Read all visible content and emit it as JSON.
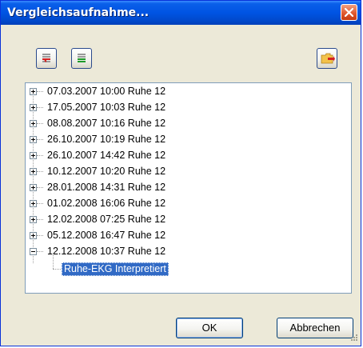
{
  "window": {
    "title": "Vergleichsaufnahme..."
  },
  "toolbar": {
    "buttons": [
      {
        "name": "list-red-icon"
      },
      {
        "name": "list-green-icon"
      },
      {
        "name": "folder-export-icon"
      }
    ]
  },
  "tree": {
    "recordings": [
      {
        "label": "07.03.2007 10:00  Ruhe 12",
        "expanded": false
      },
      {
        "label": "17.05.2007 10:03  Ruhe 12",
        "expanded": false
      },
      {
        "label": "08.08.2007 10:16  Ruhe 12",
        "expanded": false
      },
      {
        "label": "26.10.2007 10:19  Ruhe 12",
        "expanded": false
      },
      {
        "label": "26.10.2007 14:42  Ruhe 12",
        "expanded": false
      },
      {
        "label": "10.12.2007 10:20  Ruhe 12",
        "expanded": false
      },
      {
        "label": "28.01.2008 14:31  Ruhe 12",
        "expanded": false
      },
      {
        "label": "01.02.2008 16:06  Ruhe 12",
        "expanded": false
      },
      {
        "label": "12.02.2008 07:25  Ruhe 12",
        "expanded": false
      },
      {
        "label": "05.12.2008 16:47  Ruhe 12",
        "expanded": false
      },
      {
        "label": "12.12.2008 10:37  Ruhe 12",
        "expanded": true
      }
    ],
    "child": {
      "label": "Ruhe-EKG Interpretiert",
      "selected": true
    }
  },
  "buttons": {
    "ok": "OK",
    "cancel": "Abbrechen"
  },
  "colors": {
    "titlebar": "#0054e3",
    "selection": "#316ac5",
    "dialog_bg": "#ece9d8",
    "close_button": "#e05a30"
  }
}
